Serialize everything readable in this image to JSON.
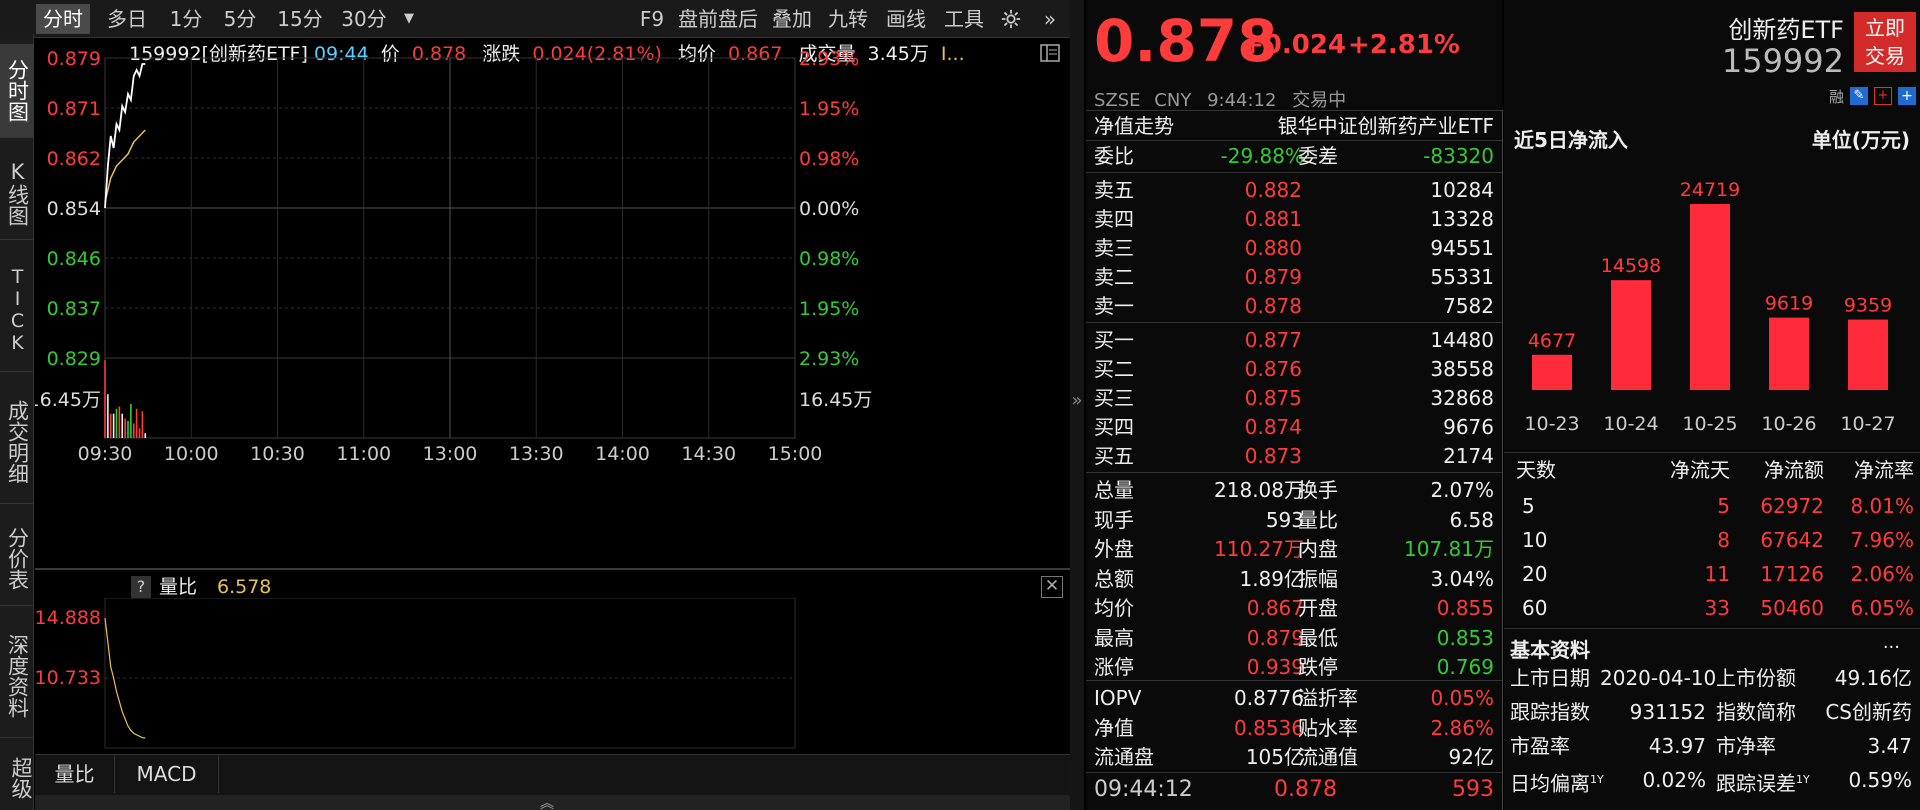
{
  "toolbar": {
    "tabs": [
      "分时",
      "多日",
      "1分",
      "5分",
      "15分",
      "30分"
    ],
    "dropdown_icon": "chevron-down-icon",
    "right": [
      "F9",
      "盘前盘后",
      "叠加",
      "九转",
      "画线",
      "工具"
    ],
    "settings_icon": "gear-icon",
    "collapse_icon": "double-chevron-right-icon"
  },
  "left_nav": [
    "分时图",
    "K线图",
    "TICK",
    "成交明细",
    "分价表",
    "深度资料",
    "超级"
  ],
  "info_bar": {
    "code": "159992[创新药ETF]",
    "time": "09:44",
    "price_label": "价",
    "price": "0.878",
    "chg_label": "涨跌",
    "chg": "0.024(2.81%)",
    "avg_label": "均价",
    "avg": "0.867",
    "vol_label": "成交量",
    "vol": "3.45万",
    "more": "I..."
  },
  "chart_data": {
    "type": "line",
    "price_ticks": [
      "0.879",
      "0.871",
      "0.862",
      "0.854",
      "0.846",
      "0.837",
      "0.829"
    ],
    "pct_ticks": [
      "2.93%",
      "1.95%",
      "0.98%",
      "0.00%",
      "0.98%",
      "1.95%",
      "2.93%"
    ],
    "vol_tick": "16.45万",
    "time_ticks": [
      "09:30",
      "10:00",
      "10:30",
      "11:00",
      "13:00",
      "13:30",
      "14:00",
      "14:30",
      "15:00"
    ],
    "ylim": [
      0.829,
      0.879
    ],
    "prev_close": 0.854,
    "price_series": [
      {
        "t": 0,
        "v": 0.854
      },
      {
        "t": 1,
        "v": 0.861
      },
      {
        "t": 2,
        "v": 0.866
      },
      {
        "t": 3,
        "v": 0.864
      },
      {
        "t": 4,
        "v": 0.868
      },
      {
        "t": 5,
        "v": 0.867
      },
      {
        "t": 6,
        "v": 0.871
      },
      {
        "t": 7,
        "v": 0.87
      },
      {
        "t": 8,
        "v": 0.873
      },
      {
        "t": 9,
        "v": 0.872
      },
      {
        "t": 10,
        "v": 0.876
      },
      {
        "t": 11,
        "v": 0.877
      },
      {
        "t": 12,
        "v": 0.876
      },
      {
        "t": 13,
        "v": 0.878
      },
      {
        "t": 14,
        "v": 0.878
      }
    ],
    "avg_series": [
      {
        "t": 0,
        "v": 0.855
      },
      {
        "t": 2,
        "v": 0.859
      },
      {
        "t": 4,
        "v": 0.861
      },
      {
        "t": 6,
        "v": 0.862
      },
      {
        "t": 8,
        "v": 0.863
      },
      {
        "t": 10,
        "v": 0.865
      },
      {
        "t": 12,
        "v": 0.866
      },
      {
        "t": 14,
        "v": 0.867
      }
    ],
    "volume_bars": [
      {
        "t": 0,
        "v": 16.0,
        "c": "red"
      },
      {
        "t": 1,
        "v": 9.0,
        "c": "white"
      },
      {
        "t": 2,
        "v": 5.0,
        "c": "red"
      },
      {
        "t": 3,
        "v": 5.0,
        "c": "white"
      },
      {
        "t": 4,
        "v": 6.0,
        "c": "green"
      },
      {
        "t": 5,
        "v": 6.5,
        "c": "red"
      },
      {
        "t": 6,
        "v": 5.0,
        "c": "white"
      },
      {
        "t": 7,
        "v": 4.0,
        "c": "red"
      },
      {
        "t": 8,
        "v": 3.5,
        "c": "green"
      },
      {
        "t": 9,
        "v": 7.0,
        "c": "green"
      },
      {
        "t": 10,
        "v": 3.0,
        "c": "red"
      },
      {
        "t": 11,
        "v": 6.0,
        "c": "red"
      },
      {
        "t": 12,
        "v": 2.0,
        "c": "red"
      },
      {
        "t": 13,
        "v": 5.5,
        "c": "red"
      },
      {
        "t": 14,
        "v": 1.0,
        "c": "white"
      }
    ]
  },
  "ratio_chart": {
    "help_label": "?",
    "label": "量比",
    "value": "6.578",
    "ticks": [
      "14.888",
      "10.733"
    ],
    "close_icon": "close-icon",
    "series": [
      14.888,
      13.2,
      11.5,
      10.733,
      9.8,
      9.1,
      8.4,
      7.9,
      7.4,
      7.1,
      6.9,
      6.8,
      6.7,
      6.6,
      6.578
    ]
  },
  "bottom_tabs": [
    "量比",
    "MACD"
  ],
  "expand_icon": "double-chevron-up-icon",
  "quote": {
    "price": "0.878",
    "change": "+0.024",
    "change_pct": "+2.81%",
    "name": "创新药ETF",
    "code": "159992",
    "trade_btn": "立即交易",
    "exchange": "SZSE",
    "currency": "CNY",
    "time": "9:44:12",
    "status": "交易中",
    "margin": "融"
  },
  "nav_header": {
    "label": "净值走势",
    "fund_name": "银华中证创新药产业ETF"
  },
  "order_ratio": {
    "wb_label": "委比",
    "wb": "-29.88%",
    "wc_label": "委差",
    "wc": "-83320"
  },
  "asks": [
    {
      "label": "卖五",
      "price": "0.882",
      "vol": "10284"
    },
    {
      "label": "卖四",
      "price": "0.881",
      "vol": "13328"
    },
    {
      "label": "卖三",
      "price": "0.880",
      "vol": "94551"
    },
    {
      "label": "卖二",
      "price": "0.879",
      "vol": "55331"
    },
    {
      "label": "卖一",
      "price": "0.878",
      "vol": "7582"
    }
  ],
  "bids": [
    {
      "label": "买一",
      "price": "0.877",
      "vol": "14480"
    },
    {
      "label": "买二",
      "price": "0.876",
      "vol": "38558"
    },
    {
      "label": "买三",
      "price": "0.875",
      "vol": "32868"
    },
    {
      "label": "买四",
      "price": "0.874",
      "vol": "9676"
    },
    {
      "label": "买五",
      "price": "0.873",
      "vol": "2174"
    }
  ],
  "stats": [
    {
      "l1": "总量",
      "v1": "218.08万",
      "c1": "white",
      "l2": "换手",
      "v2": "2.07%",
      "c2": "white"
    },
    {
      "l1": "现手",
      "v1": "593",
      "c1": "white",
      "l2": "量比",
      "v2": "6.58",
      "c2": "white"
    },
    {
      "l1": "外盘",
      "v1": "110.27万",
      "c1": "red",
      "l2": "内盘",
      "v2": "107.81万",
      "c2": "green"
    },
    {
      "l1": "总额",
      "v1": "1.89亿",
      "c1": "white",
      "l2": "振幅",
      "v2": "3.04%",
      "c2": "white"
    },
    {
      "l1": "均价",
      "v1": "0.867",
      "c1": "red",
      "l2": "开盘",
      "v2": "0.855",
      "c2": "red"
    },
    {
      "l1": "最高",
      "v1": "0.879",
      "c1": "red",
      "l2": "最低",
      "v2": "0.853",
      "c2": "green"
    },
    {
      "l1": "涨停",
      "v1": "0.939",
      "c1": "red",
      "l2": "跌停",
      "v2": "0.769",
      "c2": "green"
    }
  ],
  "etf_stats": [
    {
      "l1": "IOPV",
      "v1": "0.8776",
      "c1": "white",
      "l2": "溢折率",
      "v2": "0.05%",
      "c2": "red"
    },
    {
      "l1": "净值",
      "v1": "0.8536",
      "c1": "red",
      "l2": "贴水率",
      "v2": "2.86%",
      "c2": "red"
    },
    {
      "l1": "流通盘",
      "v1": "105亿",
      "c1": "white",
      "l2": "流通值",
      "v2": "92亿",
      "c2": "white"
    }
  ],
  "last_tick": {
    "time": "09:44:12",
    "price": "0.878",
    "vol": "593"
  },
  "flow": {
    "title": "近5日净流入",
    "unit": "单位(万元)",
    "chart_data": {
      "type": "bar",
      "categories": [
        "10-23",
        "10-24",
        "10-25",
        "10-26",
        "10-27"
      ],
      "values": [
        4677,
        14598,
        24719,
        9619,
        9359
      ],
      "value_labels": [
        "4677",
        "14598",
        "24719",
        "9619",
        "9359"
      ]
    },
    "table_headers": [
      "天数",
      "净流天",
      "净流额",
      "净流率"
    ],
    "table_rows": [
      [
        "5",
        "5",
        "62972",
        "8.01%"
      ],
      [
        "10",
        "8",
        "67642",
        "7.96%"
      ],
      [
        "20",
        "11",
        "17126",
        "2.06%"
      ],
      [
        "60",
        "33",
        "50460",
        "6.05%"
      ]
    ]
  },
  "basic": {
    "title": "基本资料",
    "more": "...",
    "rows": [
      {
        "l1": "上市日期",
        "v1": "2020-04-10",
        "l2": "上市份额",
        "v2": "49.16亿"
      },
      {
        "l1": "跟踪指数",
        "v1": "931152",
        "l2": "指数简称",
        "v2": "CS创新药"
      },
      {
        "l1": "市盈率",
        "v1": "43.97",
        "l2": "市净率",
        "v2": "3.47"
      },
      {
        "l1": "日均偏离",
        "sup1": "1Y",
        "v1": "0.02%",
        "l2": "跟踪误差",
        "sup2": "1Y",
        "v2": "0.59%"
      }
    ]
  }
}
